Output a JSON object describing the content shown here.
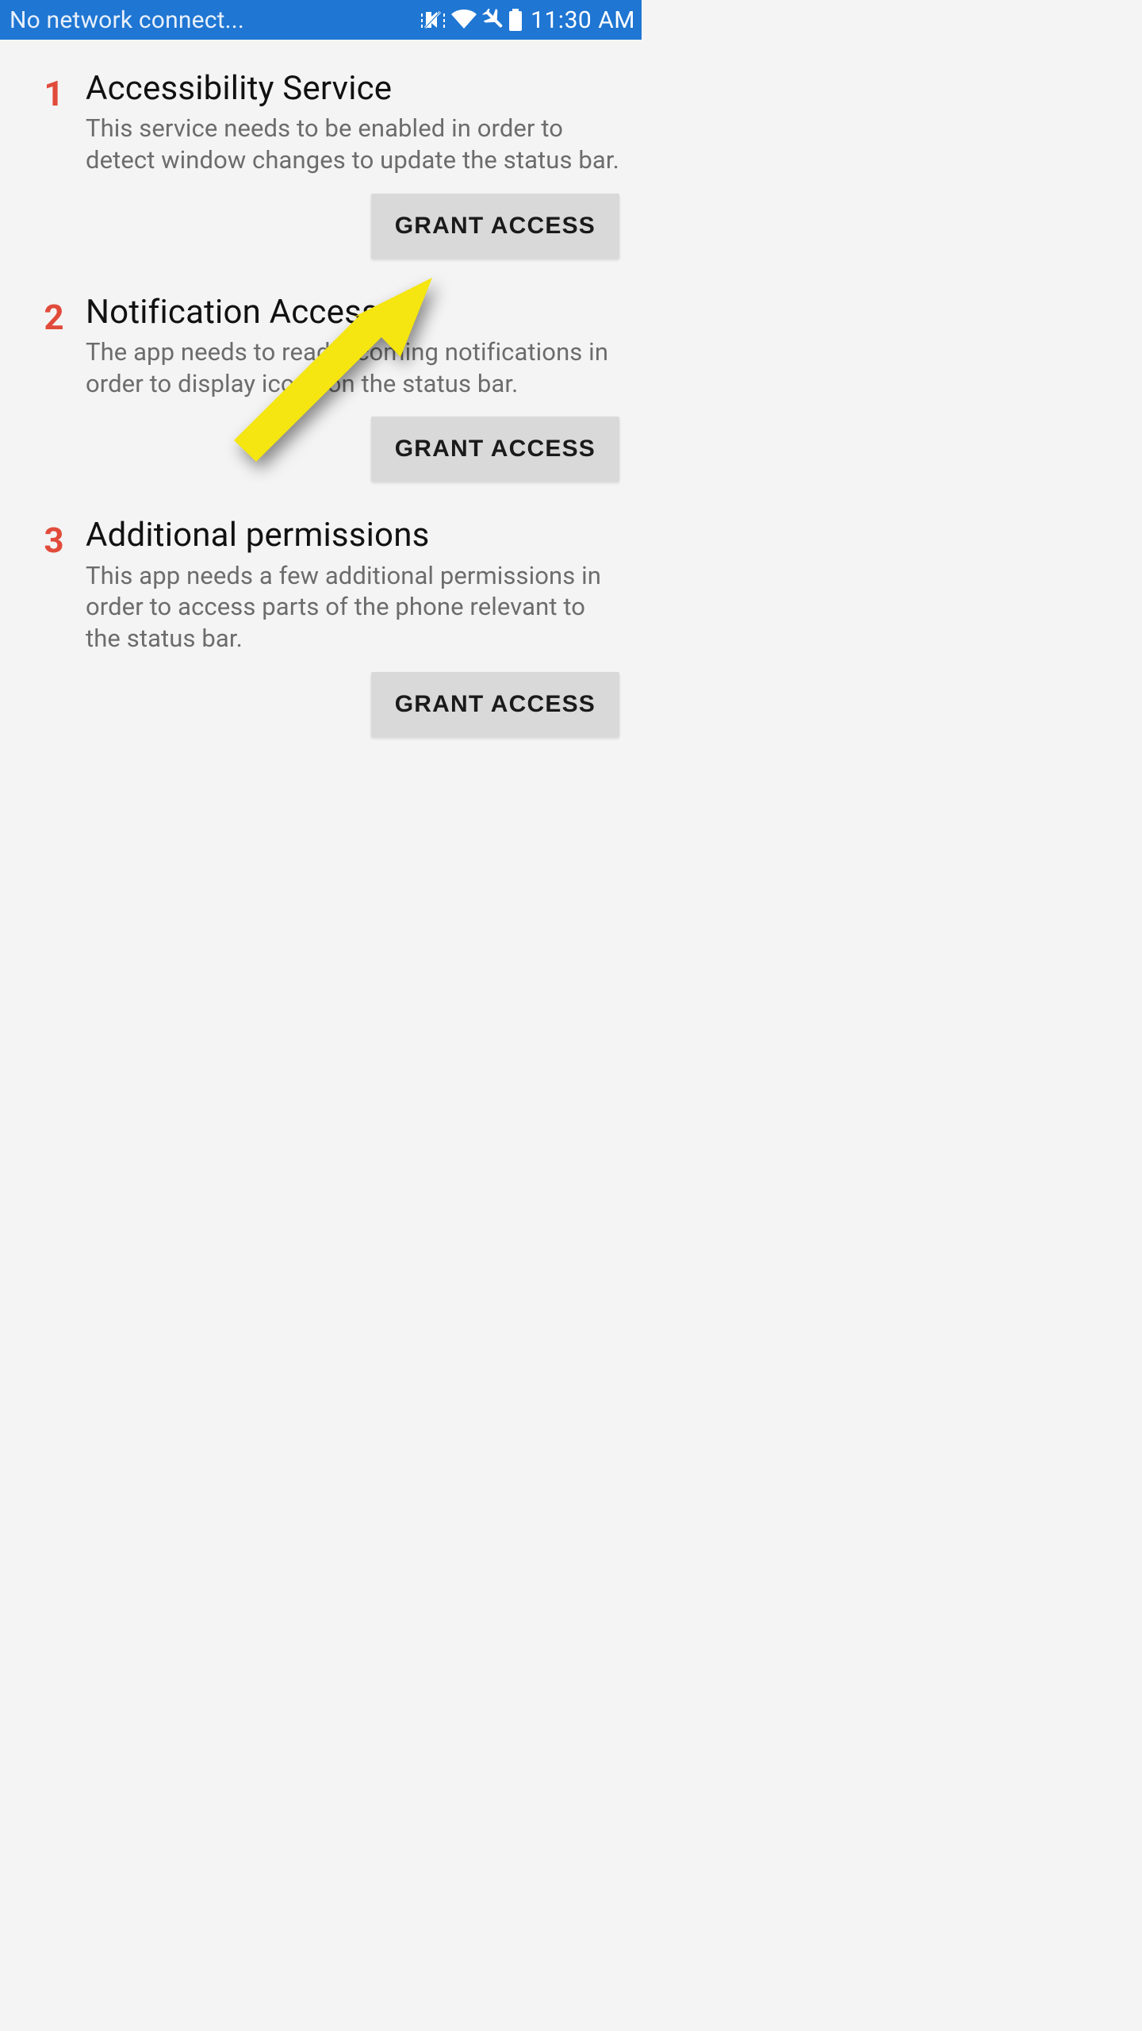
{
  "status_bar": {
    "notification_text": "No network connect...",
    "clock": "11:30 AM",
    "icons": {
      "vibrate": "vibrate-mute-icon",
      "wifi": "wifi-icon",
      "airplane": "airplane-icon",
      "battery": "battery-full-icon"
    }
  },
  "accent_number_color": "#E14B3B",
  "annotation_arrow_color": "#F5E510",
  "steps": [
    {
      "num": "1",
      "title": "Accessibility Service",
      "desc": "This service needs to be enabled in order to detect window changes to update the status bar.",
      "button": "GRANT ACCESS"
    },
    {
      "num": "2",
      "title": "Notification Access",
      "desc": "The app needs to read incoming notifications in order to display icons on the status bar.",
      "button": "GRANT ACCESS"
    },
    {
      "num": "3",
      "title": "Additional permissions",
      "desc": "This app needs a few additional permissions in order to access parts of the phone relevant to the status bar.",
      "button": "GRANT ACCESS"
    }
  ]
}
